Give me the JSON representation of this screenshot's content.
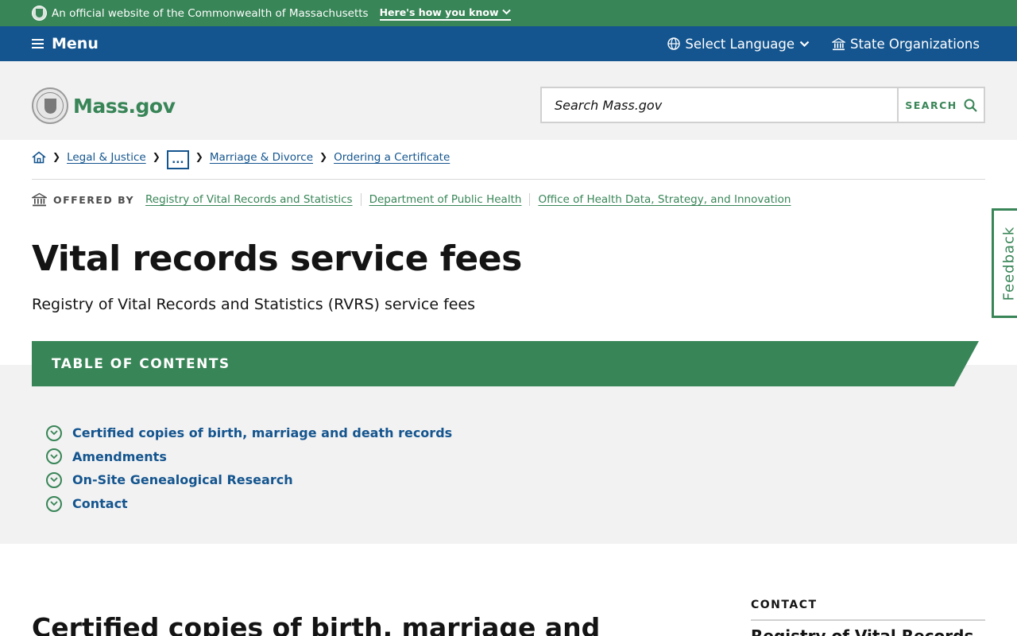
{
  "topbar": {
    "text": "An official website of the Commonwealth of Massachusetts",
    "how_label": "Here's how you know"
  },
  "nav": {
    "menu_label": "Menu",
    "language_label": "Select Language",
    "orgs_label": "State Organizations"
  },
  "header": {
    "logo_text": "Mass.gov",
    "search_placeholder": "Search Mass.gov",
    "search_button": "SEARCH"
  },
  "breadcrumb": {
    "items": [
      "Legal & Justice",
      "...",
      "Marriage & Divorce",
      "Ordering a Certificate"
    ]
  },
  "offered_by": {
    "label": "OFFERED BY",
    "agencies": [
      "Registry of Vital Records and Statistics",
      "Department of Public Health",
      "Office of Health Data, Strategy, and Innovation"
    ]
  },
  "page": {
    "title": "Vital records service fees",
    "subtitle": "Registry of Vital Records and Statistics (RVRS) service fees"
  },
  "feedback_label": "Feedback",
  "toc": {
    "heading": "TABLE OF CONTENTS",
    "items": [
      "Certified copies of birth, marriage and death records",
      "Amendments",
      "On-Site Genealogical Research",
      "Contact"
    ]
  },
  "section": {
    "heading": "Certified copies of birth, marriage and"
  },
  "sidebar": {
    "contact_label": "CONTACT",
    "contact_name": "Registry of Vital Records"
  },
  "colors": {
    "green": "#388557",
    "blue": "#14558f",
    "gray_bg": "#f2f2f2"
  }
}
